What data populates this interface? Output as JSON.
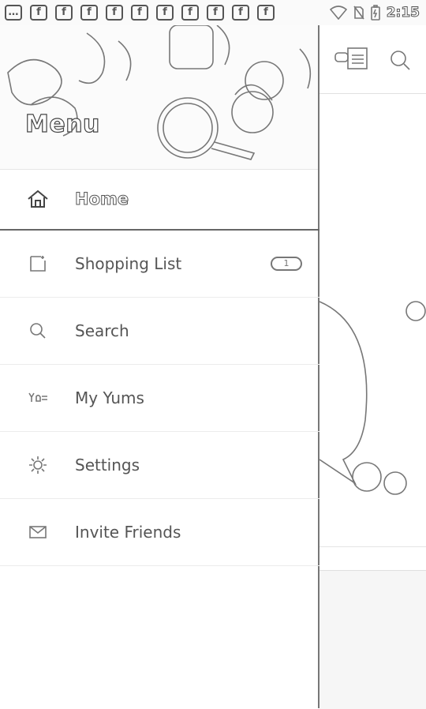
{
  "status_bar": {
    "time": "2:15",
    "notification_icons": [
      "more-icon",
      "facebook-icon",
      "facebook-icon",
      "facebook-icon",
      "facebook-icon",
      "facebook-icon",
      "facebook-icon",
      "facebook-icon",
      "facebook-icon",
      "facebook-icon",
      "facebook-icon"
    ],
    "facebook_glyph": "f",
    "more_glyph": "…"
  },
  "drawer": {
    "title": "Menu",
    "home_label": "Home",
    "items": [
      {
        "label": "Shopping List",
        "icon": "shopping-list-icon",
        "badge": "1"
      },
      {
        "label": "Search",
        "icon": "search-icon"
      },
      {
        "label": "My Yums",
        "icon": "yums-icon"
      },
      {
        "label": "Settings",
        "icon": "gear-icon"
      },
      {
        "label": "Invite Friends",
        "icon": "envelope-icon"
      }
    ]
  }
}
